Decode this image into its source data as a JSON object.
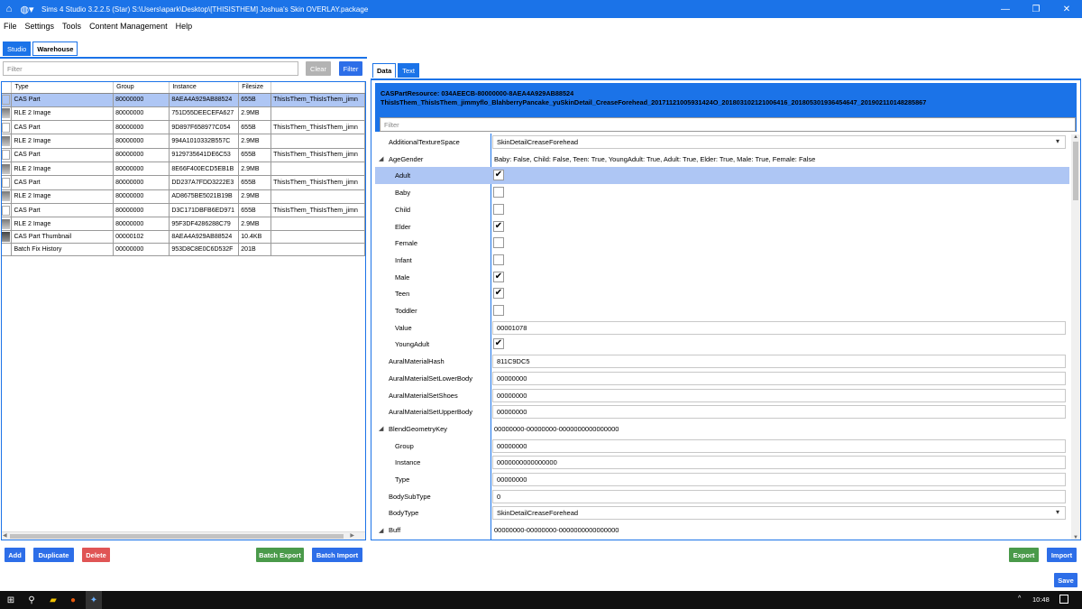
{
  "window": {
    "title": "Sims 4 Studio 3.2.2.5 (Star)  S:\\Users\\apark\\Desktop\\[THISISTHEM] Joshua's Skin OVERLAY.package",
    "home_icon": "home-icon",
    "palette_icon": "palette-icon",
    "minimize": "—",
    "restore": "❐",
    "close": "✕"
  },
  "menu": [
    "File",
    "Settings",
    "Tools",
    "Content Management",
    "Help"
  ],
  "left_tabs": [
    "Studio",
    "Warehouse"
  ],
  "left_filter": {
    "placeholder": "Filter",
    "clear_label": "Clear",
    "filter_label": "Filter"
  },
  "table": {
    "headers": [
      "Type",
      "Group",
      "Instance",
      "Filesize",
      ""
    ],
    "rows": [
      {
        "type": "CAS Part",
        "group": "80000000",
        "instance": "8AEA4A929AB88524",
        "size": "655B",
        "name": "ThisIsThem_ThisIsThem_jimn",
        "icon": "blank"
      },
      {
        "type": "RLE 2 Image",
        "group": "80000000",
        "instance": "751D55DEECEFA627",
        "size": "2.9MB",
        "name": "",
        "icon": "thumb"
      },
      {
        "type": "CAS Part",
        "group": "80000000",
        "instance": "9D897F658977C054",
        "size": "655B",
        "name": "ThisIsThem_ThisIsThem_jimn",
        "icon": "blank"
      },
      {
        "type": "RLE 2 Image",
        "group": "80000000",
        "instance": "994A1010332B557C",
        "size": "2.9MB",
        "name": "",
        "icon": "thumb"
      },
      {
        "type": "CAS Part",
        "group": "80000000",
        "instance": "9129735641DE6C53",
        "size": "655B",
        "name": "ThisIsThem_ThisIsThem_jimn",
        "icon": "blank"
      },
      {
        "type": "RLE 2 Image",
        "group": "80000000",
        "instance": "8E66F400ECD5EB1B",
        "size": "2.9MB",
        "name": "",
        "icon": "thumb"
      },
      {
        "type": "CAS Part",
        "group": "80000000",
        "instance": "DD237A7FDD3222E3",
        "size": "655B",
        "name": "ThisIsThem_ThisIsThem_jimn",
        "icon": "blank"
      },
      {
        "type": "RLE 2 Image",
        "group": "80000000",
        "instance": "AD8675BE5021B19B",
        "size": "2.9MB",
        "name": "",
        "icon": "thumb"
      },
      {
        "type": "CAS Part",
        "group": "80000000",
        "instance": "D3C171DBFB6ED971",
        "size": "655B",
        "name": "ThisIsThem_ThisIsThem_jimn",
        "icon": "blank"
      },
      {
        "type": "RLE 2 Image",
        "group": "80000000",
        "instance": "95F3DF4286288C79",
        "size": "2.9MB",
        "name": "",
        "icon": "thumb"
      },
      {
        "type": "CAS Part Thumbnail",
        "group": "00000102",
        "instance": "8AEA4A929AB88524",
        "size": "10.4KB",
        "name": "",
        "icon": "thumb2"
      },
      {
        "type": "Batch Fix History",
        "group": "00000000",
        "instance": "953D8C8E0C6D532F",
        "size": "201B",
        "name": "",
        "icon": "none"
      }
    ]
  },
  "right_tabs": [
    "Data",
    "Text"
  ],
  "resource_header": {
    "line1": "CASPartResource: 034AEECB-80000000-8AEA4A929AB88524",
    "line2": "ThisIsThem_ThisIsThem_jimmyflo_BlahberryPancake_yuSkinDetail_CreaseForehead_20171121005931424O_20180310212100641​6_20180530193645464​7_20190211014828​5867",
    "filter_placeholder": "Filter"
  },
  "properties": [
    {
      "name": "AdditionalTextureSpace",
      "kind": "combo",
      "value": "SkinDetailCreaseForehead",
      "indent": 0,
      "arrow": ""
    },
    {
      "name": "AgeGender",
      "kind": "text",
      "value": "Baby: False, Child: False, Teen: True, YoungAdult: True, Adult: True, Elder: True, Male: True, Female: False",
      "indent": 0,
      "arrow": "◢"
    },
    {
      "name": "Adult",
      "kind": "check",
      "value": "✔",
      "indent": 1,
      "arrow": "",
      "selected": true
    },
    {
      "name": "Baby",
      "kind": "check",
      "value": "",
      "indent": 1,
      "arrow": ""
    },
    {
      "name": "Child",
      "kind": "check",
      "value": "",
      "indent": 1,
      "arrow": ""
    },
    {
      "name": "Elder",
      "kind": "check",
      "value": "✔",
      "indent": 1,
      "arrow": ""
    },
    {
      "name": "Female",
      "kind": "check",
      "value": "",
      "indent": 1,
      "arrow": ""
    },
    {
      "name": "Infant",
      "kind": "check",
      "value": "",
      "indent": 1,
      "arrow": ""
    },
    {
      "name": "Male",
      "kind": "check",
      "value": "✔",
      "indent": 1,
      "arrow": ""
    },
    {
      "name": "Teen",
      "kind": "check",
      "value": "✔",
      "indent": 1,
      "arrow": ""
    },
    {
      "name": "Toddler",
      "kind": "check",
      "value": "",
      "indent": 1,
      "arrow": ""
    },
    {
      "name": "Value",
      "kind": "input",
      "value": "00001078",
      "indent": 1,
      "arrow": ""
    },
    {
      "name": "YoungAdult",
      "kind": "check",
      "value": "✔",
      "indent": 1,
      "arrow": ""
    },
    {
      "name": "AuralMaterialHash",
      "kind": "input",
      "value": "811C9DC5",
      "indent": 0,
      "arrow": ""
    },
    {
      "name": "AuralMaterialSetLowerBody",
      "kind": "input",
      "value": "00000000",
      "indent": 0,
      "arrow": ""
    },
    {
      "name": "AuralMaterialSetShoes",
      "kind": "input",
      "value": "00000000",
      "indent": 0,
      "arrow": ""
    },
    {
      "name": "AuralMaterialSetUpperBody",
      "kind": "input",
      "value": "00000000",
      "indent": 0,
      "arrow": ""
    },
    {
      "name": "BlendGeometryKey",
      "kind": "text",
      "value": "00000000-00000000-0000000000000000",
      "indent": 0,
      "arrow": "◢"
    },
    {
      "name": "Group",
      "kind": "input",
      "value": "00000000",
      "indent": 1,
      "arrow": ""
    },
    {
      "name": "Instance",
      "kind": "input",
      "value": "0000000000000000",
      "indent": 1,
      "arrow": ""
    },
    {
      "name": "Type",
      "kind": "input",
      "value": "00000000",
      "indent": 1,
      "arrow": ""
    },
    {
      "name": "BodySubType",
      "kind": "input",
      "value": "0",
      "indent": 0,
      "arrow": ""
    },
    {
      "name": "BodyType",
      "kind": "combo",
      "value": "SkinDetailCreaseForehead",
      "indent": 0,
      "arrow": ""
    },
    {
      "name": "Buff",
      "kind": "text",
      "value": "00000000-00000000-0000000000000000",
      "indent": 0,
      "arrow": "◢"
    }
  ],
  "bottom_left_buttons": {
    "add": "Add",
    "duplicate": "Duplicate",
    "delete": "Delete",
    "batch_export": "Batch Export",
    "batch_import": "Batch Import"
  },
  "bottom_right_buttons": {
    "export": "Export",
    "import": "Import",
    "save": "Save"
  },
  "taskbar": {
    "time": "10:48",
    "caret": "^"
  },
  "colors": {
    "accent": "#1b73e8",
    "selection": "#aec6f4",
    "delete": "#e05555",
    "export": "#4a9a4a"
  }
}
